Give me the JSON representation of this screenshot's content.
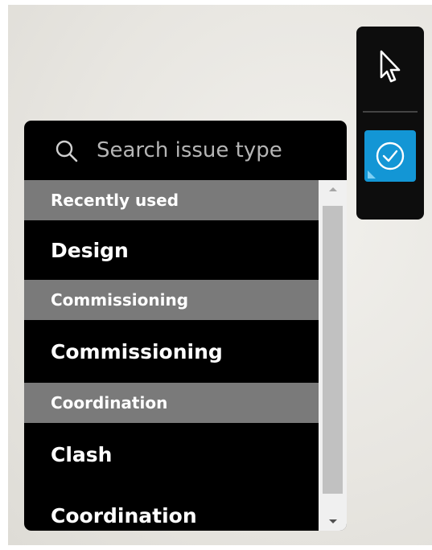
{
  "toolbar": {
    "tools": [
      {
        "name": "select",
        "icon": "cursor-arrow-icon"
      },
      {
        "name": "issue",
        "icon": "check-circle-icon",
        "active": true
      }
    ],
    "active_color": "#1396d5"
  },
  "dropdown": {
    "search": {
      "placeholder": "Search issue type"
    },
    "groups": [
      {
        "header": "Recently used",
        "items": [
          "Design"
        ]
      },
      {
        "header": "Commissioning",
        "items": [
          "Commissioning"
        ]
      },
      {
        "header": "Coordination",
        "items": [
          "Clash",
          "Coordination"
        ]
      }
    ]
  }
}
